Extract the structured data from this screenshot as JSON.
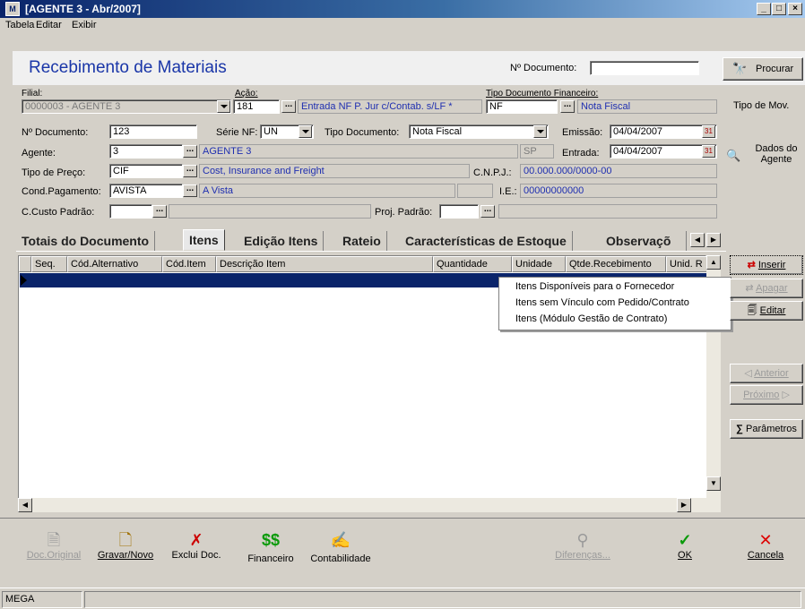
{
  "window": {
    "title": "[AGENTE 3 - Abr/2007]"
  },
  "menu": [
    "Tabela",
    "Editar",
    "Exibir"
  ],
  "header": {
    "page_title": "Recebimento de Materiais",
    "doc_number_label": "Nº Documento:",
    "doc_number_value": "",
    "search_button": "Procurar"
  },
  "filial": {
    "label": "Filial:",
    "value": "0000003 - AGENTE 3"
  },
  "acao": {
    "label": "Ação:",
    "code": "181",
    "desc": "Entrada NF P. Jur c/Contab. s/LF *"
  },
  "tipo_doc_fin": {
    "label": "Tipo Documento Financeiro:",
    "code": "NF",
    "desc": "Nota Fiscal"
  },
  "tipo_mov": "Tipo de Mov.",
  "form": {
    "num_doc_label": "Nº Documento:",
    "num_doc": "123",
    "serie_label": "Série NF:",
    "serie": "UN",
    "tipo_doc_label": "Tipo Documento:",
    "tipo_doc": "Nota Fiscal",
    "emissao_label": "Emissão:",
    "emissao": "04/04/2007",
    "agente_label": "Agente:",
    "agente_code": "3",
    "agente_name": "AGENTE 3",
    "uf": "SP",
    "entrada_label": "Entrada:",
    "entrada": "04/04/2007",
    "tipo_preco_label": "Tipo de Preço:",
    "tipo_preco": "CIF",
    "tipo_preco_desc": "Cost, Insurance and Freight",
    "cnpj_label": "C.N.P.J.:",
    "cnpj": "00.000.000/0000-00",
    "cond_pag_label": "Cond.Pagamento:",
    "cond_pag": "AVISTA",
    "cond_pag_desc": "A Vista",
    "ie_label": "I.E.:",
    "ie": "00000000000",
    "ccusto_label": "C.Custo Padrão:",
    "ccusto": "",
    "proj_label": "Proj. Padrão:",
    "proj": ""
  },
  "dados_agente": "Dados do Agente",
  "tabs": [
    "Totais do Documento",
    "Itens",
    "Edição Itens",
    "Rateio",
    "Características de Estoque",
    "Observaçõ"
  ],
  "grid": {
    "columns": [
      "Seq.",
      "Cód.Alternativo",
      "Cód.Item",
      "Descrição Item",
      "Quantidade",
      "Unidade",
      "Qtde.Recebimento",
      "Unid. R"
    ]
  },
  "popup_menu": [
    "Itens Disponíveis para o Fornecedor",
    "Itens sem Vínculo com Pedido/Contrato",
    "Itens (Módulo Gestão de Contrato)"
  ],
  "side_buttons": {
    "inserir": "Inserir",
    "apagar": "Apagar",
    "editar": "Editar",
    "anterior": "Anterior",
    "proximo": "Próximo",
    "parametros": "Parâmetros"
  },
  "toolbar": {
    "doc_original": "Doc.Original",
    "gravar": "Gravar/Novo",
    "exclui": "Exclui Doc.",
    "financeiro": "Financeiro",
    "contabilidade": "Contabilidade",
    "diferencas": "Diferenças...",
    "ok": "OK",
    "cancela": "Cancela"
  },
  "status": {
    "company": "MEGA"
  },
  "colors": {
    "title_blue": "#1a36a8",
    "selection": "#0a246a",
    "lookup_text": "#1f2fb0"
  }
}
